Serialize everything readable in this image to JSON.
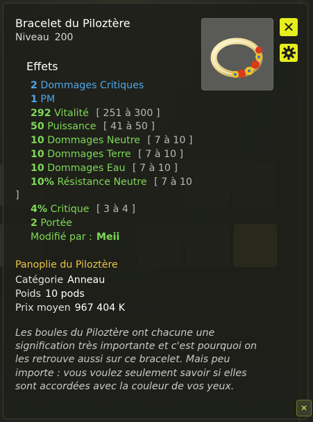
{
  "item": {
    "title": "Bracelet du Piloztère",
    "level_label": "Niveau",
    "level_value": "200"
  },
  "effects": {
    "heading": "Effets",
    "list": [
      {
        "num": "2",
        "name": "Dommages Critiques",
        "range": "",
        "color": "blue"
      },
      {
        "num": "1",
        "name": "PM",
        "range": "",
        "color": "blue"
      },
      {
        "num": "292",
        "name": "Vitalité",
        "range": "[ 251 à 300 ]",
        "color": "green"
      },
      {
        "num": "50",
        "name": "Puissance",
        "range": "[ 41 à 50 ]",
        "color": "green"
      },
      {
        "num": "10",
        "name": "Dommages Neutre",
        "range": "[ 7 à 10 ]",
        "color": "green"
      },
      {
        "num": "10",
        "name": "Dommages Terre",
        "range": "[ 7 à 10 ]",
        "color": "green"
      },
      {
        "num": "10",
        "name": "Dommages Eau",
        "range": "[ 7 à 10 ]",
        "color": "green"
      },
      {
        "num": "10%",
        "name": "Résistance Neutre",
        "range": "[ 7 à 10",
        "range_cont": "]",
        "color": "green"
      },
      {
        "num": "4%",
        "name": "Critique",
        "range": "[ 3 à 4 ]",
        "color": "green"
      },
      {
        "num": "2",
        "name": "Portée",
        "range": "",
        "color": "green"
      }
    ],
    "modified_label": "Modifié par :",
    "modified_by": "Meii"
  },
  "panoplie": "Panoplie du Piloztère",
  "details": {
    "category_label": "Catégorie",
    "category_value": "Anneau",
    "weight_label": "Poids",
    "weight_value": "10 pods",
    "price_label": "Prix moyen",
    "price_value": "967 404 K"
  },
  "description": "Les boules du Piloztère ont chacune une signification très importante et c'est pourquoi on les retrouve aussi sur ce bracelet. Mais peu importe : vous voulez seulement savoir si elles sont accordées avec la couleur de vos yeux.",
  "colors": {
    "accent_button": "#e7ee1e",
    "effect_blue": "#4fa6e8",
    "effect_green": "#7ed957",
    "panoplie": "#e8c34a"
  },
  "icons": {
    "close": "close-icon",
    "settings": "gear-icon",
    "item": "bracelet-item-icon"
  }
}
